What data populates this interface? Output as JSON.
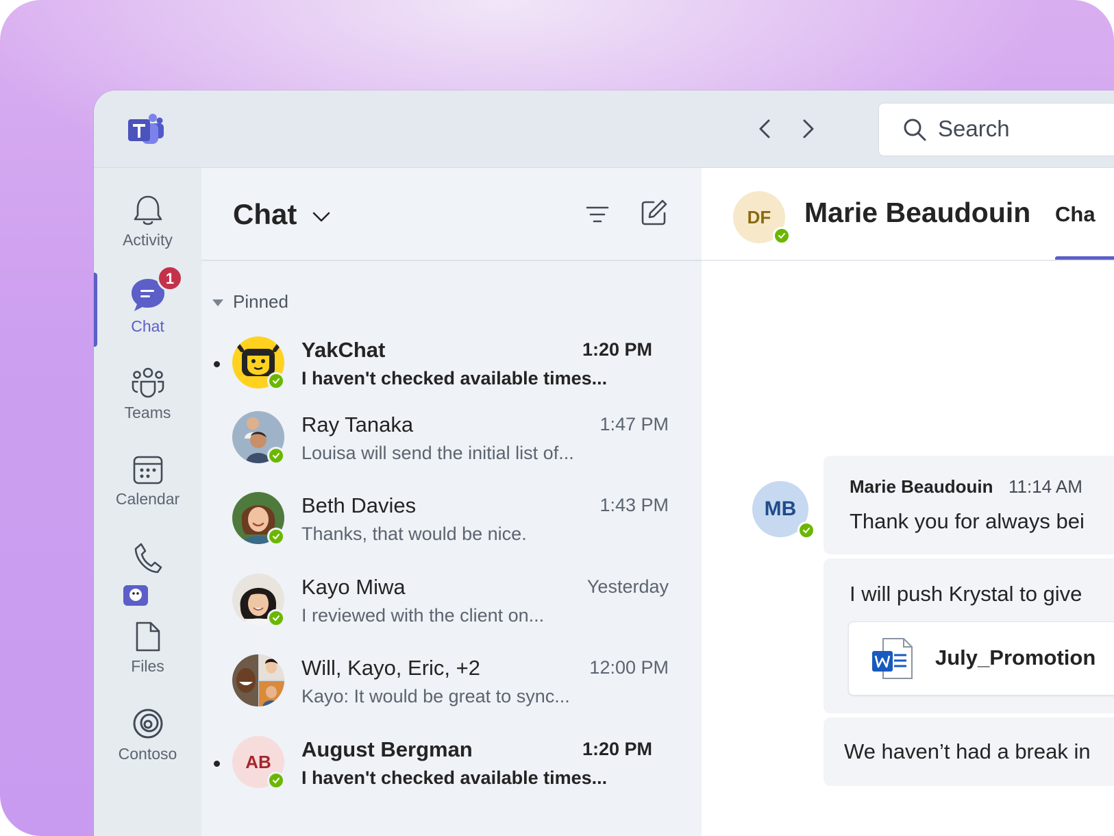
{
  "app": {
    "nav": {
      "back_label": "Back",
      "forward_label": "Forward"
    },
    "search": {
      "placeholder": "Search"
    }
  },
  "rail": {
    "items": [
      {
        "label": "Activity",
        "icon": "bell-icon"
      },
      {
        "label": "Chat",
        "icon": "chat-icon",
        "badge": "1",
        "active": true
      },
      {
        "label": "Teams",
        "icon": "teams-icon"
      },
      {
        "label": "Calendar",
        "icon": "calendar-icon"
      },
      {
        "label": "",
        "icon": "phone-icon"
      },
      {
        "label": "Files",
        "icon": "file-icon"
      },
      {
        "label": "Contoso",
        "icon": "contoso-icon"
      }
    ]
  },
  "chat_list": {
    "title": "Chat",
    "section": "Pinned",
    "rows": [
      {
        "name": "YakChat",
        "time": "1:20 PM",
        "preview": "I haven't checked available times...",
        "unread": true
      },
      {
        "name": "Ray Tanaka",
        "time": "1:47 PM",
        "preview": "Louisa will send the initial list of..."
      },
      {
        "name": "Beth Davies",
        "time": "1:43 PM",
        "preview": "Thanks, that would be nice."
      },
      {
        "name": "Kayo Miwa",
        "time": "Yesterday",
        "preview": "I reviewed with the client on..."
      },
      {
        "name": "Will, Kayo, Eric, +2",
        "time": "12:00 PM",
        "preview": "Kayo: It would be great to sync..."
      },
      {
        "name": "August Bergman",
        "initials": "AB",
        "time": "1:20 PM",
        "preview": "I haven't checked available times...",
        "unread": true
      }
    ]
  },
  "conversation": {
    "avatar_initials": "DF",
    "name": "Marie Beaudouin",
    "tab": "Cha",
    "sender_initials": "MB",
    "messages": [
      {
        "sender": "Marie Beaudouin",
        "time": "11:14 AM",
        "text": "Thank you for always bei"
      },
      {
        "text": "I will push Krystal to give",
        "attachment": "July_Promotion"
      },
      {
        "text": "We haven’t had a break in"
      }
    ]
  },
  "colors": {
    "accent": "#5b5fc7",
    "presence": "#6bb700",
    "badge": "#c4314b"
  }
}
